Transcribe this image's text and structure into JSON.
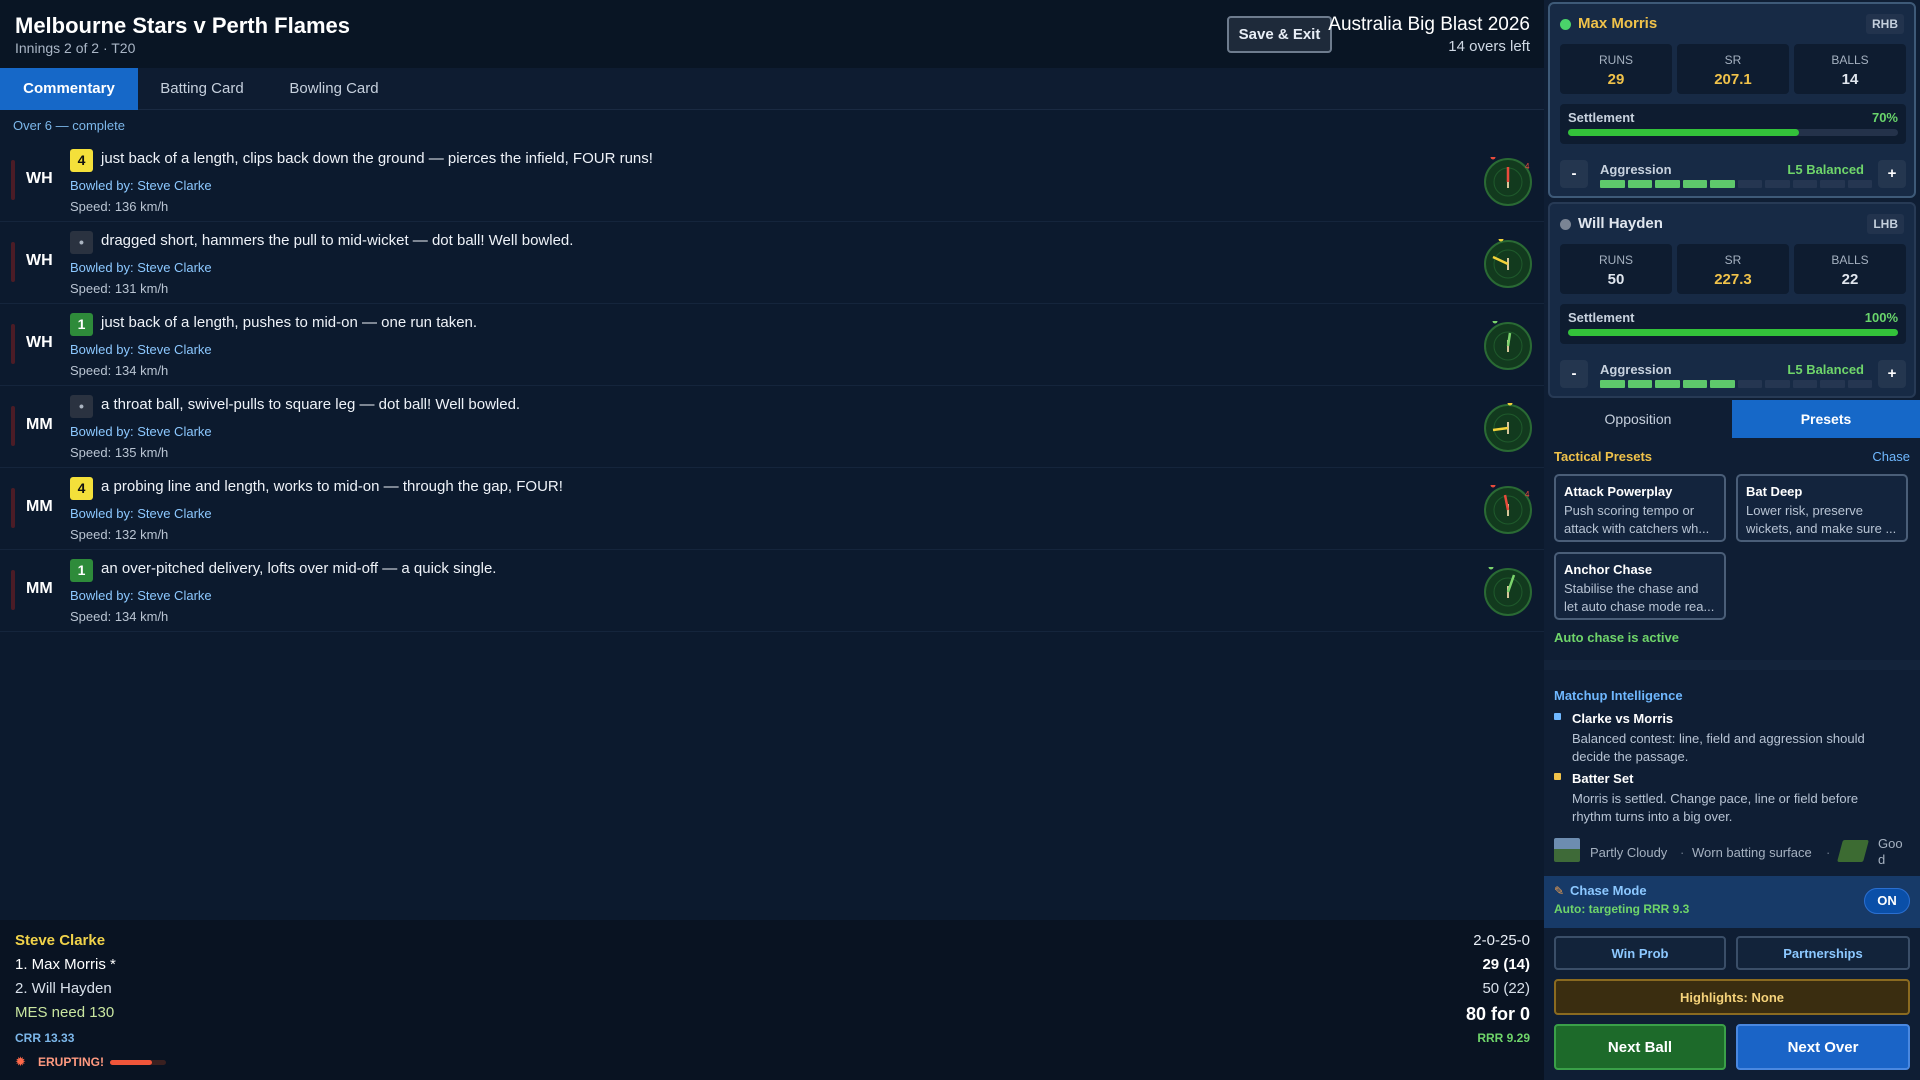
{
  "header": {
    "title": "Melbourne Stars v Perth Flames",
    "subtitle": "Innings 2 of 2 · T20",
    "save_exit": "Save & Exit",
    "competition": "Australia Big Blast 2026",
    "overs_left": "14 overs left"
  },
  "tabs": [
    "Commentary",
    "Batting Card",
    "Bowling Card"
  ],
  "over_label": "Over 6 — complete",
  "balls": [
    {
      "batter": "WH",
      "outcome": "4",
      "type": "four",
      "text": "just back of a length, clips back down the ground — pierces the infield, FOUR runs!",
      "bowled": "Bowled by: Steve Clarke",
      "speed": "Speed: 136 km/h",
      "wagon_label": "4"
    },
    {
      "batter": "WH",
      "outcome": "•",
      "type": "dot",
      "text": "dragged short, hammers the pull to mid-wicket — dot ball! Well bowled.",
      "bowled": "Bowled by: Steve Clarke",
      "speed": "Speed: 131 km/h",
      "wagon_label": ""
    },
    {
      "batter": "WH",
      "outcome": "1",
      "type": "one",
      "text": "just back of a length, pushes to mid-on — one run taken.",
      "bowled": "Bowled by: Steve Clarke",
      "speed": "Speed: 134 km/h",
      "wagon_label": ""
    },
    {
      "batter": "MM",
      "outcome": "•",
      "type": "dot",
      "text": "a throat ball, swivel-pulls to square leg — dot ball! Well bowled.",
      "bowled": "Bowled by: Steve Clarke",
      "speed": "Speed: 135 km/h",
      "wagon_label": ""
    },
    {
      "batter": "MM",
      "outcome": "4",
      "type": "four",
      "text": "a probing line and length, works to mid-on — through the gap, FOUR!",
      "bowled": "Bowled by: Steve Clarke",
      "speed": "Speed: 132 km/h",
      "wagon_label": "4"
    },
    {
      "batter": "MM",
      "outcome": "1",
      "type": "one",
      "text": "an over-pitched delivery, lofts over mid-off — a quick single.",
      "bowled": "Bowled by: Steve Clarke",
      "speed": "Speed: 134 km/h",
      "wagon_label": ""
    }
  ],
  "scorebar": {
    "bowler": "Steve Clarke",
    "bowler_figures": "2-0-25-0",
    "batter1": "1. Max Morris *",
    "batter1_score": "29 (14)",
    "batter2": "2. Will Hayden",
    "batter2_score": "50 (22)",
    "need": "MES need 130",
    "total": "80 for 0",
    "crr": "CRR 13.33",
    "rrr": "RRR 9.29",
    "crowd": "ERUPTING!",
    "crowd_level": 0.75
  },
  "batters": [
    {
      "name": "Max Morris",
      "hand": "RHB",
      "runs_label": "RUNS",
      "runs": "29",
      "sr_label": "SR",
      "sr": "207.1",
      "balls_label": "BALLS",
      "balls": "14",
      "settlement_label": "Settlement",
      "settlement": "70%",
      "settlement_value": 0.7,
      "aggression_label": "Aggression",
      "aggression_level": "L5 Balanced",
      "aggression_segments_on": 5,
      "aggression_segments_total": 10,
      "minus": "-",
      "plus": "+",
      "active": true
    },
    {
      "name": "Will Hayden",
      "hand": "LHB",
      "runs_label": "RUNS",
      "runs": "50",
      "sr_label": "SR",
      "sr": "227.3",
      "balls_label": "BALLS",
      "balls": "22",
      "settlement_label": "Settlement",
      "settlement": "100%",
      "settlement_value": 1.0,
      "aggression_label": "Aggression",
      "aggression_level": "L5 Balanced",
      "aggression_segments_on": 5,
      "aggression_segments_total": 10,
      "minus": "-",
      "plus": "+",
      "active": false
    }
  ],
  "right_tabs": [
    "Opposition",
    "Presets"
  ],
  "presets": {
    "title": "Tactical Presets",
    "mode": "Chase",
    "items": [
      {
        "title": "Attack Powerplay",
        "desc1": "Push scoring tempo or",
        "desc2": "attack with catchers wh..."
      },
      {
        "title": "Bat Deep",
        "desc1": "Lower risk, preserve",
        "desc2": "wickets, and make sure ..."
      },
      {
        "title": "Anchor Chase",
        "desc1": "Stabilise the chase and",
        "desc2": "let auto chase mode rea..."
      }
    ],
    "auto_status": "Auto chase is active"
  },
  "matchup": {
    "title": "Matchup Intelligence",
    "items": [
      {
        "title": "Clarke vs Morris",
        "line1": "Balanced contest: line, field and aggression should",
        "line2": "decide the passage.",
        "color": "#6fb8ff"
      },
      {
        "title": "Batter Set",
        "line1": "Morris is settled. Change pace, line or field before",
        "line2": "rhythm turns into a big over.",
        "color": "#f0c24a"
      }
    ],
    "weather": "Partly Cloudy",
    "pitch": "Worn batting surface",
    "outfield1": "Goo",
    "outfield2": "d"
  },
  "chase": {
    "title": "Chase Mode",
    "status": "Auto: targeting RRR 9.3",
    "toggle": "ON"
  },
  "buttons": {
    "win_prob": "Win Prob",
    "partnerships": "Partnerships",
    "highlights": "Highlights: None",
    "next_ball": "Next Ball",
    "next_over": "Next Over"
  },
  "colors": {
    "accent": "#1668c8",
    "four": "#f4e03a",
    "single": "#2e8b3a",
    "green_btn": "#1d6a2a",
    "blue_btn": "#1a64c7",
    "amber": "#f0c24a"
  }
}
